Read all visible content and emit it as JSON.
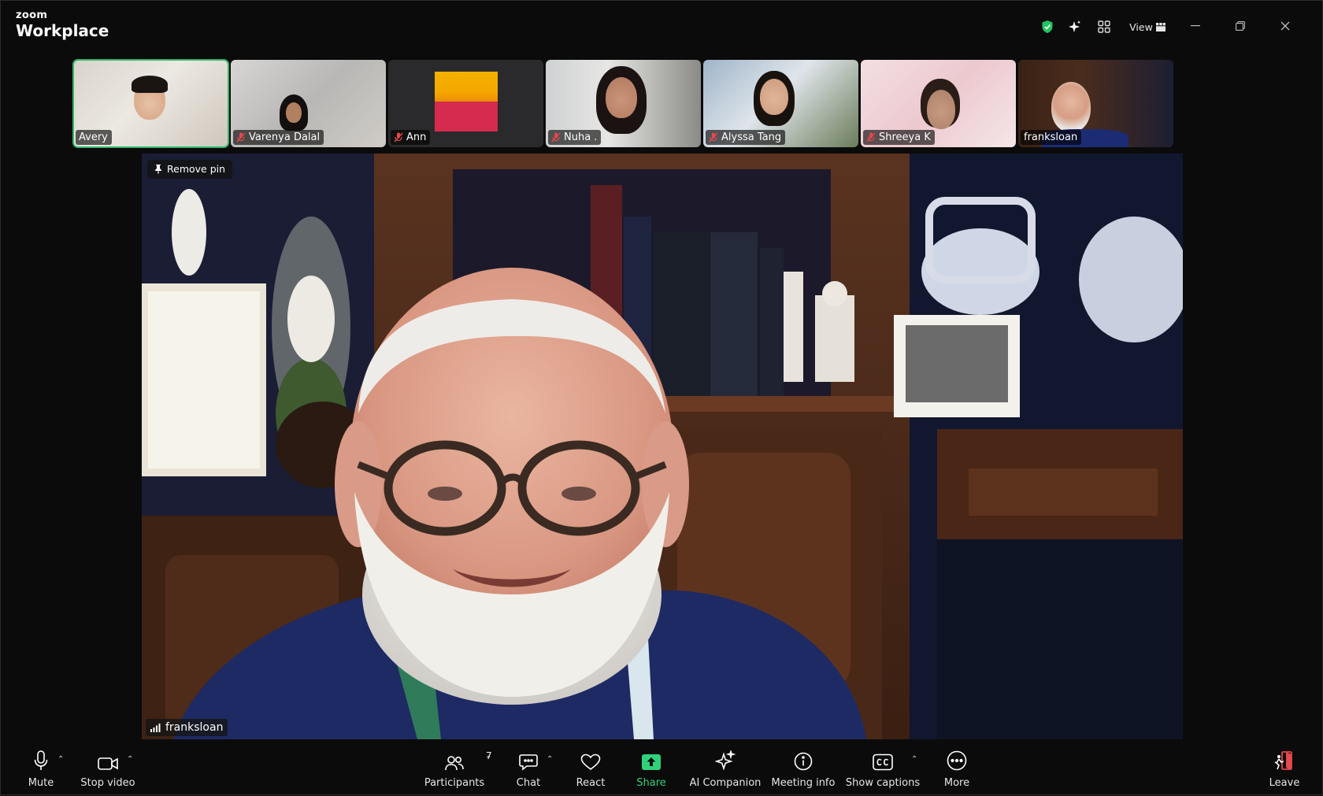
{
  "app": {
    "brand_small": "zoom",
    "brand_large": "Workplace"
  },
  "titlebar": {
    "view_label": "View"
  },
  "participants": [
    {
      "name": "Avery",
      "muted": false,
      "active": true
    },
    {
      "name": "Varenya Dalal",
      "muted": true,
      "active": false
    },
    {
      "name": "Ann",
      "muted": true,
      "active": false
    },
    {
      "name": "Nuha .",
      "muted": true,
      "active": false
    },
    {
      "name": "Alyssa Tang",
      "muted": true,
      "active": false
    },
    {
      "name": "Shreeya K",
      "muted": true,
      "active": false
    },
    {
      "name": "franksloan",
      "muted": false,
      "active": false
    }
  ],
  "main_video": {
    "pin_label": "Remove pin",
    "speaker_name": "franksloan"
  },
  "toolbar": {
    "mute": "Mute",
    "stop_video": "Stop video",
    "participants": "Participants",
    "participant_count": "7",
    "chat": "Chat",
    "react": "React",
    "share": "Share",
    "ai_companion": "AI Companion",
    "meeting_info": "Meeting info",
    "show_captions": "Show captions",
    "more": "More",
    "leave": "Leave"
  },
  "colors": {
    "active_border": "#2fb86a",
    "share_green": "#2fd27a",
    "leave_red": "#e5484d",
    "secure_green": "#22c55e"
  }
}
